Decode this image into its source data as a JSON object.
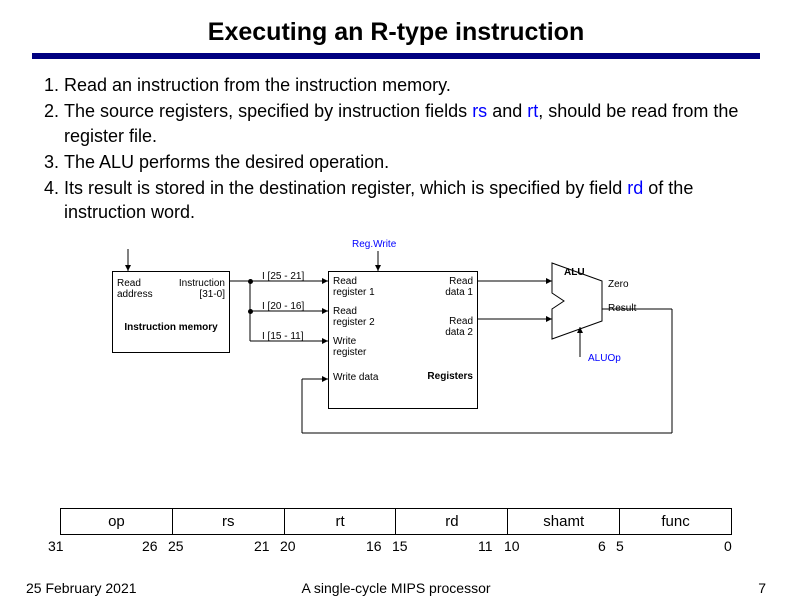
{
  "title": "Executing an R-type instruction",
  "steps": {
    "s1": "Read an instruction from the instruction memory.",
    "s2a": "The source registers, specified by instruction fields ",
    "rs": "rs",
    "s2b": " and ",
    "rt": "rt",
    "s2c": ", should be read from the register file.",
    "s3": "The ALU performs the desired operation.",
    "s4a": "Its result is stored in the destination register, which is specified by field ",
    "rd": "rd",
    "s4b": " of the instruction word."
  },
  "diagram": {
    "regwrite": "Reg.Write",
    "imem_read_addr": "Read address",
    "imem_instr": "Instruction [31-0]",
    "imem_name": "Instruction memory",
    "bits25_21": "I [25 - 21]",
    "bits20_16": "I [20 - 16]",
    "bits15_11": "I [15 - 11]",
    "read_reg1": "Read register 1",
    "read_reg2": "Read register 2",
    "write_reg": "Write register",
    "write_data": "Write data",
    "read_data1": "Read data 1",
    "read_data2": "Read data 2",
    "registers": "Registers",
    "alu": "ALU",
    "zero": "Zero",
    "result": "Result",
    "aluop": "ALUOp"
  },
  "fmt": {
    "op": "op",
    "rs": "rs",
    "rt": "rt",
    "rd": "rd",
    "shamt": "shamt",
    "func": "func",
    "b31": "31",
    "b26": "26",
    "b25": "25",
    "b21": "21",
    "b20": "20",
    "b16": "16",
    "b15": "15",
    "b11": "11",
    "b10": "10",
    "b6": "6",
    "b5": "5",
    "b0": "0"
  },
  "footer": {
    "date": "25 February 2021",
    "caption": "A single-cycle MIPS processor",
    "page": "7"
  },
  "chart_data": {
    "type": "table",
    "title": "R-type instruction format bit fields",
    "fields": [
      {
        "name": "op",
        "high": 31,
        "low": 26,
        "width": 6
      },
      {
        "name": "rs",
        "high": 25,
        "low": 21,
        "width": 5
      },
      {
        "name": "rt",
        "high": 20,
        "low": 16,
        "width": 5
      },
      {
        "name": "rd",
        "high": 15,
        "low": 11,
        "width": 5
      },
      {
        "name": "shamt",
        "high": 10,
        "low": 6,
        "width": 5
      },
      {
        "name": "func",
        "high": 5,
        "low": 0,
        "width": 6
      }
    ],
    "datapath": {
      "blocks": [
        "Instruction memory",
        "Registers",
        "ALU"
      ],
      "signals": [
        "Reg.Write",
        "ALUOp",
        "Zero",
        "Result"
      ],
      "register_file_inputs": [
        "Read register 1 (I[25-21])",
        "Read register 2 (I[20-16])",
        "Write register (I[15-11])",
        "Write data"
      ],
      "register_file_outputs": [
        "Read data 1",
        "Read data 2"
      ]
    }
  }
}
